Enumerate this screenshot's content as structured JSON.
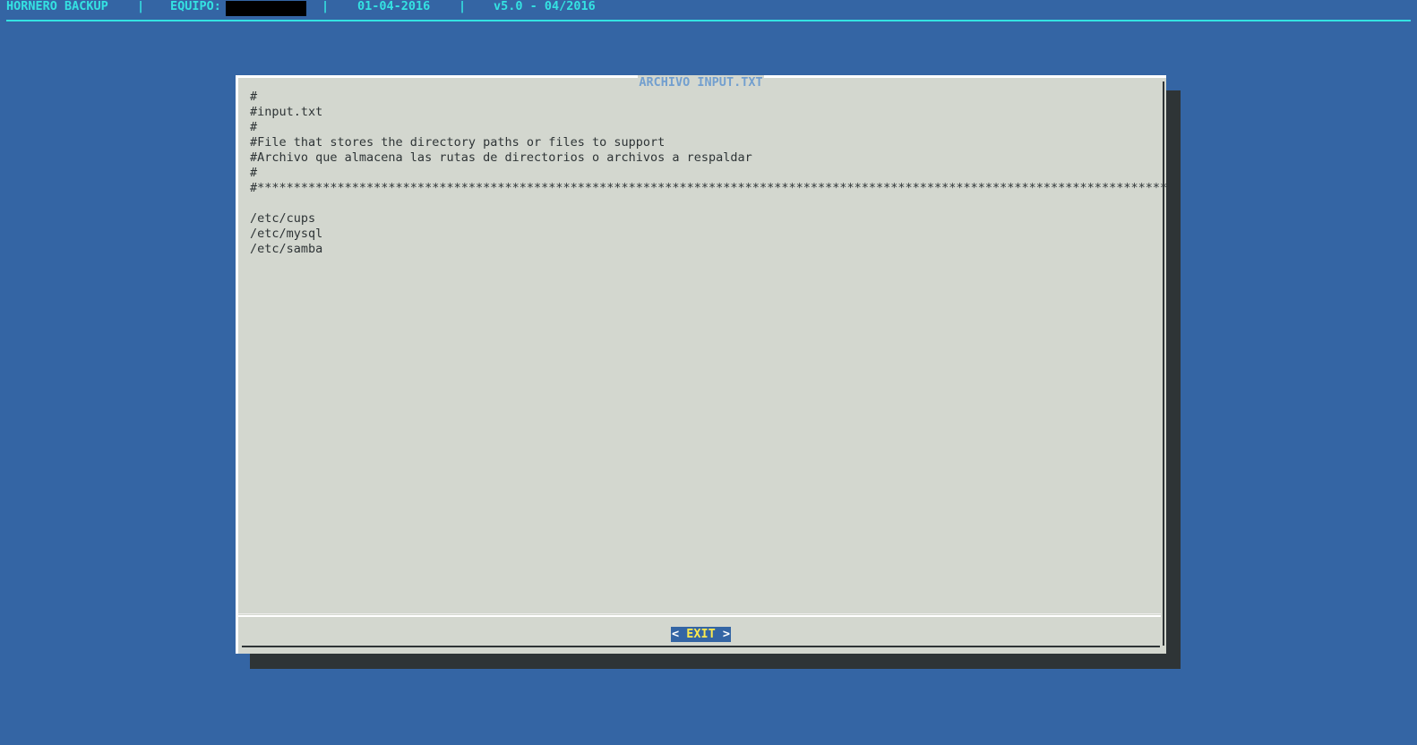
{
  "topbar": {
    "app_name": "HORNERO BACKUP",
    "sep1": "|",
    "equipo_label": "EQUIPO:",
    "sep2": "|",
    "date": "01-04-2016",
    "sep3": "|",
    "version": "v5.0 - 04/2016"
  },
  "dialog": {
    "title": "ARCHIVO INPUT.TXT",
    "lines": [
      "#",
      "#input.txt",
      "#",
      "#File that stores the directory paths or files to support",
      "#Archivo que almacena las rutas de directorios o archivos a respaldar",
      "#",
      "#*****************************************************************************************************************************",
      "",
      "/etc/cups",
      "/etc/mysql",
      "/etc/samba"
    ],
    "exit_button": {
      "left_bracket": "<",
      "hotkey": "E",
      "label": "XIT",
      "right_bracket": ">"
    }
  },
  "colors": {
    "background": "#3465a4",
    "topbar_text": "#34e2e2",
    "dialog_bg": "#d3d7cf",
    "title_text": "#729fcf",
    "shadow": "#2e3436",
    "button_bg": "#3465a4",
    "hotkey": "#fce94f"
  }
}
